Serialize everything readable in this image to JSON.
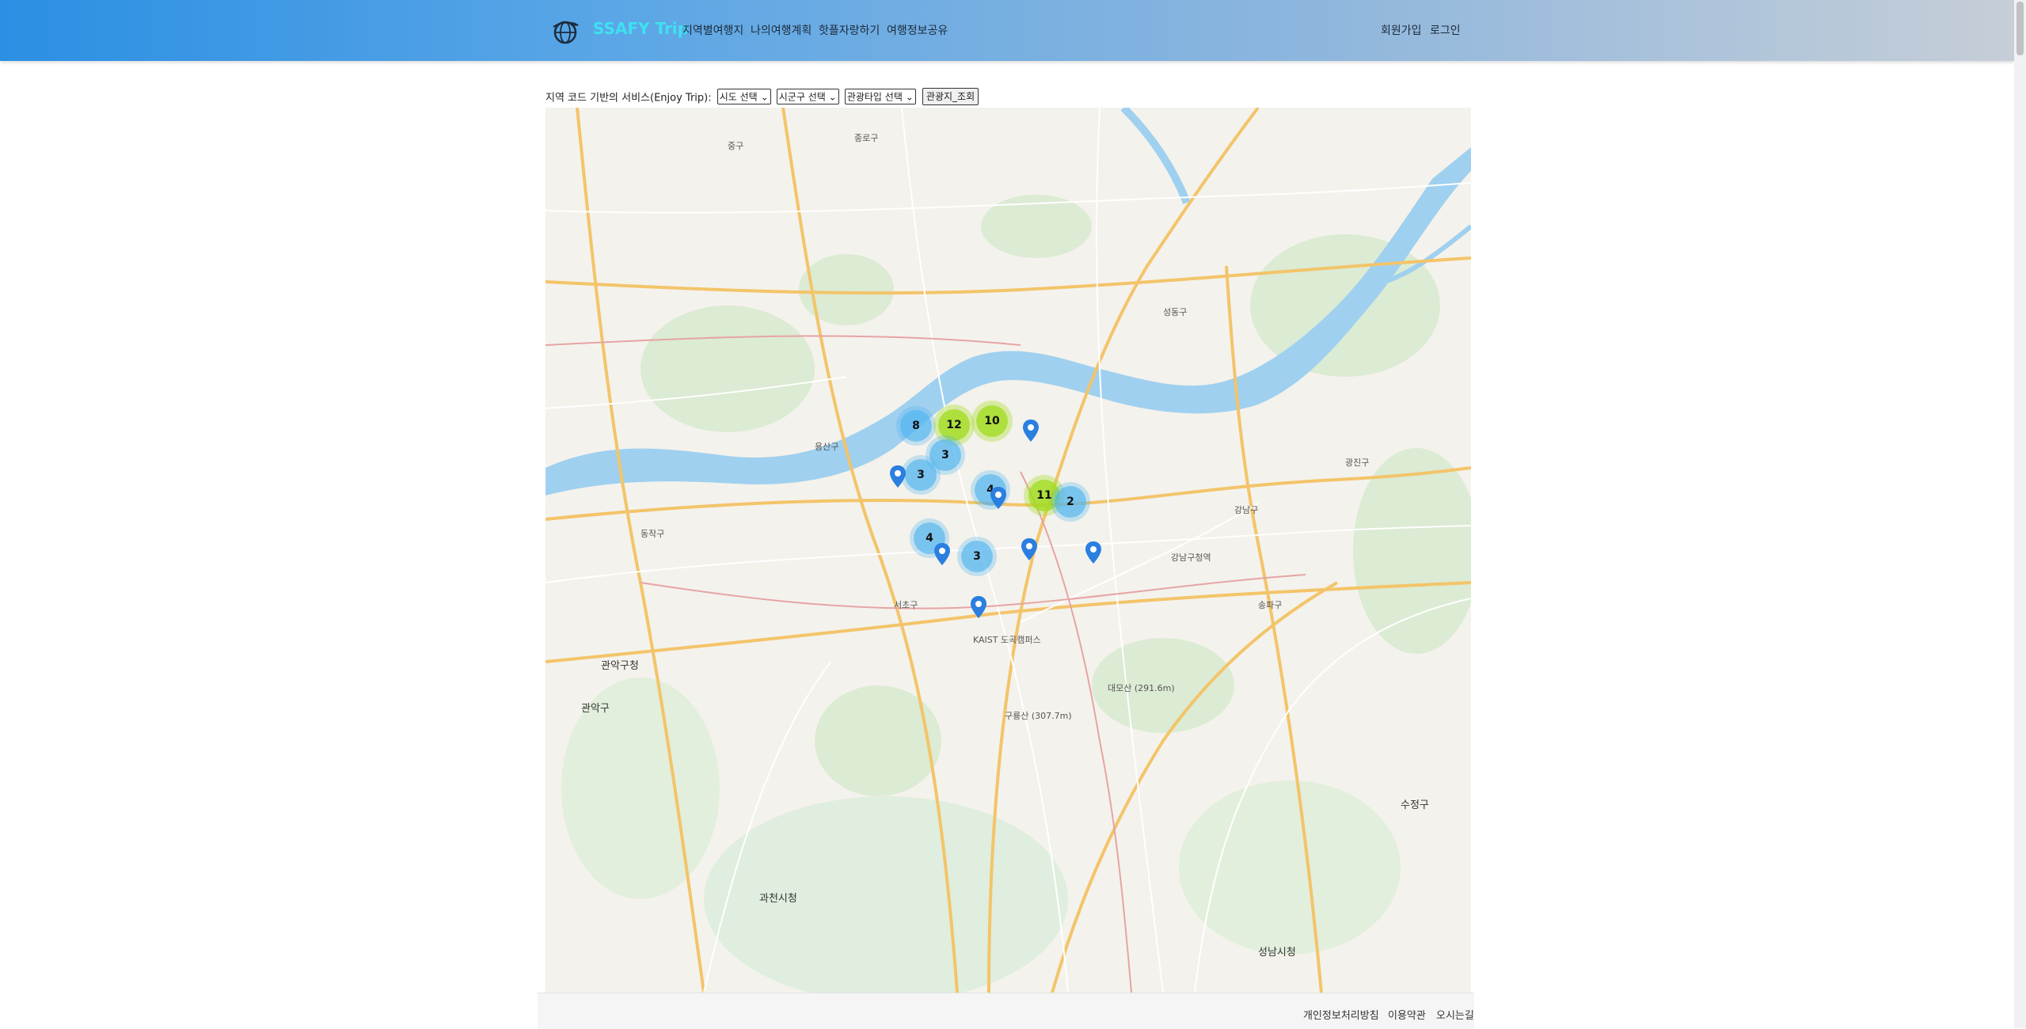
{
  "header": {
    "brand": "SSAFY Trip",
    "nav": [
      "지역별여행지",
      "나의여행계획",
      "핫플자랑하기",
      "여행정보공유"
    ],
    "signup": "회원가입",
    "login": "로그인"
  },
  "search": {
    "label": "지역 코드 기반의 서비스(Enjoy Trip):",
    "sido": "시도 선택",
    "sigungu": "시군구 선택",
    "content_type": "관광타입 선택",
    "submit": "관광지_조회"
  },
  "map": {
    "clusters": [
      "8",
      "12",
      "10",
      "3",
      "3",
      "4",
      "11",
      "2",
      "4",
      "3"
    ],
    "labels": [
      "중구",
      "종로구",
      "성동구",
      "광진구",
      "용산구",
      "동작구",
      "관악구청",
      "관악구",
      "서초구",
      "강남구",
      "송파구",
      "수정구",
      "과천시청",
      "성남시청",
      "대모산 (291.6m)",
      "구룡산 (307.7m)",
      "KAIST 도곡캠퍼스",
      "강남구청역"
    ]
  },
  "footer": {
    "links": [
      "개인정보처리방침",
      "이용약관",
      "오시는길"
    ]
  },
  "colors": {
    "header_start": "#2b8fe3",
    "header_end": "#c6ced8",
    "brand": "#3fe0f0",
    "cluster_small": "#50b4f0",
    "cluster_mid": "#a0dc1e",
    "river": "#9fd0ef",
    "pin": "#2a7fe0"
  }
}
